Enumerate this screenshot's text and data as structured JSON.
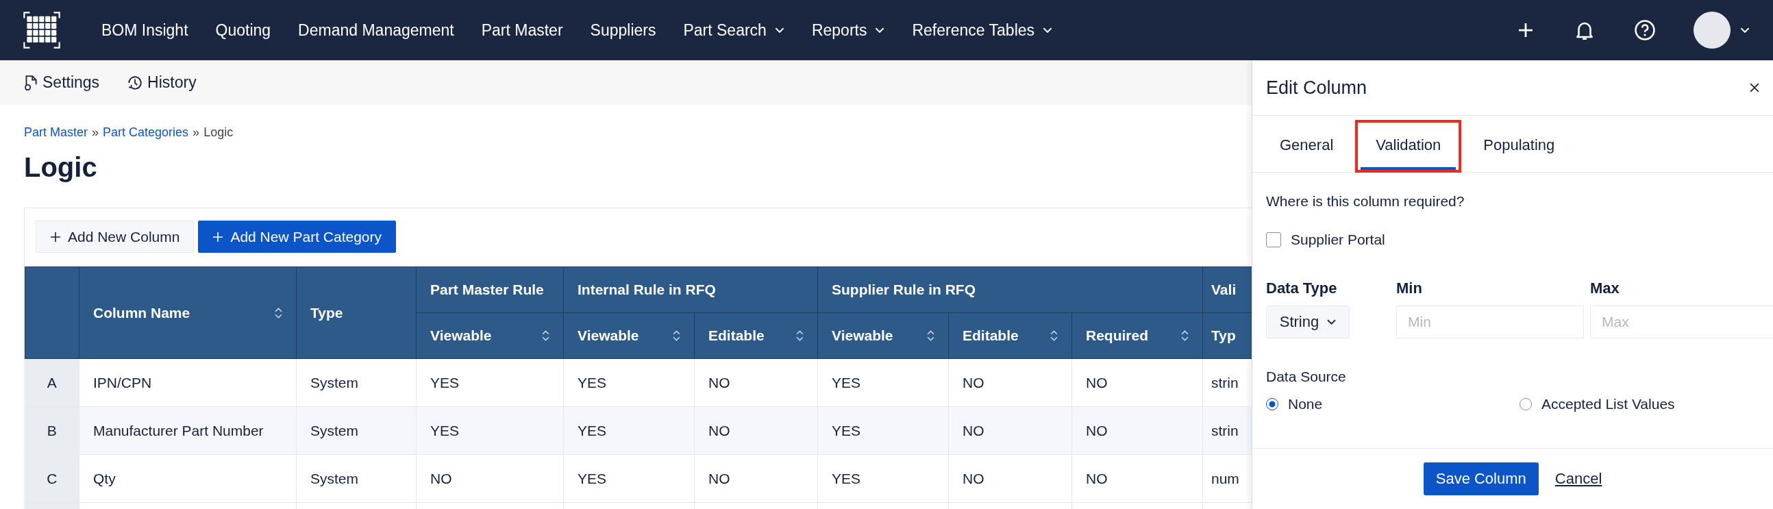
{
  "nav": {
    "items": [
      {
        "label": "BOM Insight",
        "dropdown": false
      },
      {
        "label": "Quoting",
        "dropdown": false
      },
      {
        "label": "Demand Management",
        "dropdown": false
      },
      {
        "label": "Part Master",
        "dropdown": false
      },
      {
        "label": "Suppliers",
        "dropdown": false
      },
      {
        "label": "Part Search",
        "dropdown": true
      },
      {
        "label": "Reports",
        "dropdown": true
      },
      {
        "label": "Reference Tables",
        "dropdown": true
      }
    ]
  },
  "subbar": {
    "items": [
      {
        "label": "Settings",
        "kind": "settings"
      },
      {
        "label": "History",
        "kind": "history"
      }
    ]
  },
  "breadcrumb": {
    "separator": "»",
    "items": [
      {
        "label": "Part Master",
        "link": true
      },
      {
        "label": "Part Categories",
        "link": true
      },
      {
        "label": "Logic",
        "link": false
      }
    ]
  },
  "page_title": "Logic",
  "toolbar": {
    "buttons": [
      {
        "label": "Add New Column",
        "kind": "secondary"
      },
      {
        "label": "Add New Part Category",
        "kind": "primary"
      }
    ]
  },
  "table": {
    "columns": [
      {
        "label": "Column Name",
        "sortable": true
      },
      {
        "label": "Type",
        "sortable": false
      }
    ],
    "groups": [
      {
        "label": "Part Master Rule",
        "columns": [
          {
            "label": "Viewable",
            "sortable": true
          }
        ]
      },
      {
        "label": "Internal Rule in RFQ",
        "columns": [
          {
            "label": "Viewable",
            "sortable": true
          },
          {
            "label": "Editable",
            "sortable": true
          }
        ]
      },
      {
        "label": "Supplier Rule in RFQ",
        "columns": [
          {
            "label": "Viewable",
            "sortable": true
          },
          {
            "label": "Editable",
            "sortable": true
          },
          {
            "label": "Required",
            "sortable": true
          }
        ]
      },
      {
        "label": "Vali",
        "columns": [
          {
            "label": "Typ"
          }
        ]
      }
    ],
    "rows": [
      {
        "index": "A",
        "cells": [
          "IPN/CPN",
          "System",
          "YES",
          "YES",
          "NO",
          "YES",
          "NO",
          "NO",
          "strin"
        ]
      },
      {
        "index": "B",
        "cells": [
          "Manufacturer Part Number",
          "System",
          "YES",
          "YES",
          "NO",
          "YES",
          "NO",
          "NO",
          "strin"
        ]
      },
      {
        "index": "C",
        "cells": [
          "Qty",
          "System",
          "NO",
          "YES",
          "NO",
          "YES",
          "NO",
          "NO",
          "num"
        ]
      }
    ]
  },
  "panel": {
    "title": "Edit Column",
    "tabs": [
      {
        "label": "General",
        "selected": false,
        "highlighted": false
      },
      {
        "label": "Validation",
        "selected": true,
        "highlighted": true
      },
      {
        "label": "Populating",
        "selected": false,
        "highlighted": false
      }
    ],
    "question": "Where is this column required?",
    "checkboxes": [
      {
        "label": "Supplier Portal",
        "checked": false
      }
    ],
    "fields": [
      {
        "label": "Data Type",
        "kind": "select",
        "value": "String"
      },
      {
        "label": "Min",
        "kind": "input",
        "placeholder": "Min"
      },
      {
        "label": "Max",
        "kind": "input",
        "placeholder": "Max"
      }
    ],
    "data_source": {
      "label": "Data Source",
      "options": [
        {
          "label": "None",
          "selected": true
        },
        {
          "label": "Accepted List Values",
          "selected": false
        }
      ]
    },
    "buttons": [
      {
        "label": "Save Column",
        "kind": "primary"
      },
      {
        "label": "Cancel",
        "kind": "link"
      }
    ]
  }
}
